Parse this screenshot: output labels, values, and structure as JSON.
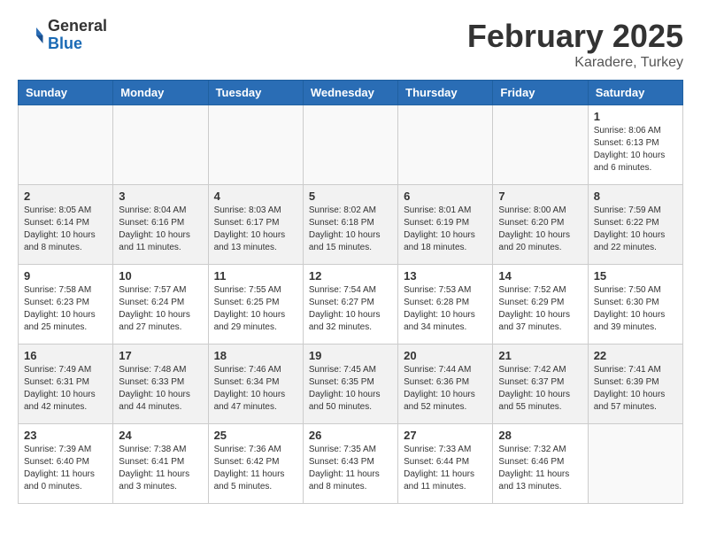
{
  "header": {
    "logo_line1": "General",
    "logo_line2": "Blue",
    "title": "February 2025",
    "subtitle": "Karadere, Turkey"
  },
  "columns": [
    "Sunday",
    "Monday",
    "Tuesday",
    "Wednesday",
    "Thursday",
    "Friday",
    "Saturday"
  ],
  "weeks": [
    {
      "alt": false,
      "days": [
        {
          "num": "",
          "info": ""
        },
        {
          "num": "",
          "info": ""
        },
        {
          "num": "",
          "info": ""
        },
        {
          "num": "",
          "info": ""
        },
        {
          "num": "",
          "info": ""
        },
        {
          "num": "",
          "info": ""
        },
        {
          "num": "1",
          "info": "Sunrise: 8:06 AM\nSunset: 6:13 PM\nDaylight: 10 hours\nand 6 minutes."
        }
      ]
    },
    {
      "alt": true,
      "days": [
        {
          "num": "2",
          "info": "Sunrise: 8:05 AM\nSunset: 6:14 PM\nDaylight: 10 hours\nand 8 minutes."
        },
        {
          "num": "3",
          "info": "Sunrise: 8:04 AM\nSunset: 6:16 PM\nDaylight: 10 hours\nand 11 minutes."
        },
        {
          "num": "4",
          "info": "Sunrise: 8:03 AM\nSunset: 6:17 PM\nDaylight: 10 hours\nand 13 minutes."
        },
        {
          "num": "5",
          "info": "Sunrise: 8:02 AM\nSunset: 6:18 PM\nDaylight: 10 hours\nand 15 minutes."
        },
        {
          "num": "6",
          "info": "Sunrise: 8:01 AM\nSunset: 6:19 PM\nDaylight: 10 hours\nand 18 minutes."
        },
        {
          "num": "7",
          "info": "Sunrise: 8:00 AM\nSunset: 6:20 PM\nDaylight: 10 hours\nand 20 minutes."
        },
        {
          "num": "8",
          "info": "Sunrise: 7:59 AM\nSunset: 6:22 PM\nDaylight: 10 hours\nand 22 minutes."
        }
      ]
    },
    {
      "alt": false,
      "days": [
        {
          "num": "9",
          "info": "Sunrise: 7:58 AM\nSunset: 6:23 PM\nDaylight: 10 hours\nand 25 minutes."
        },
        {
          "num": "10",
          "info": "Sunrise: 7:57 AM\nSunset: 6:24 PM\nDaylight: 10 hours\nand 27 minutes."
        },
        {
          "num": "11",
          "info": "Sunrise: 7:55 AM\nSunset: 6:25 PM\nDaylight: 10 hours\nand 29 minutes."
        },
        {
          "num": "12",
          "info": "Sunrise: 7:54 AM\nSunset: 6:27 PM\nDaylight: 10 hours\nand 32 minutes."
        },
        {
          "num": "13",
          "info": "Sunrise: 7:53 AM\nSunset: 6:28 PM\nDaylight: 10 hours\nand 34 minutes."
        },
        {
          "num": "14",
          "info": "Sunrise: 7:52 AM\nSunset: 6:29 PM\nDaylight: 10 hours\nand 37 minutes."
        },
        {
          "num": "15",
          "info": "Sunrise: 7:50 AM\nSunset: 6:30 PM\nDaylight: 10 hours\nand 39 minutes."
        }
      ]
    },
    {
      "alt": true,
      "days": [
        {
          "num": "16",
          "info": "Sunrise: 7:49 AM\nSunset: 6:31 PM\nDaylight: 10 hours\nand 42 minutes."
        },
        {
          "num": "17",
          "info": "Sunrise: 7:48 AM\nSunset: 6:33 PM\nDaylight: 10 hours\nand 44 minutes."
        },
        {
          "num": "18",
          "info": "Sunrise: 7:46 AM\nSunset: 6:34 PM\nDaylight: 10 hours\nand 47 minutes."
        },
        {
          "num": "19",
          "info": "Sunrise: 7:45 AM\nSunset: 6:35 PM\nDaylight: 10 hours\nand 50 minutes."
        },
        {
          "num": "20",
          "info": "Sunrise: 7:44 AM\nSunset: 6:36 PM\nDaylight: 10 hours\nand 52 minutes."
        },
        {
          "num": "21",
          "info": "Sunrise: 7:42 AM\nSunset: 6:37 PM\nDaylight: 10 hours\nand 55 minutes."
        },
        {
          "num": "22",
          "info": "Sunrise: 7:41 AM\nSunset: 6:39 PM\nDaylight: 10 hours\nand 57 minutes."
        }
      ]
    },
    {
      "alt": false,
      "days": [
        {
          "num": "23",
          "info": "Sunrise: 7:39 AM\nSunset: 6:40 PM\nDaylight: 11 hours\nand 0 minutes."
        },
        {
          "num": "24",
          "info": "Sunrise: 7:38 AM\nSunset: 6:41 PM\nDaylight: 11 hours\nand 3 minutes."
        },
        {
          "num": "25",
          "info": "Sunrise: 7:36 AM\nSunset: 6:42 PM\nDaylight: 11 hours\nand 5 minutes."
        },
        {
          "num": "26",
          "info": "Sunrise: 7:35 AM\nSunset: 6:43 PM\nDaylight: 11 hours\nand 8 minutes."
        },
        {
          "num": "27",
          "info": "Sunrise: 7:33 AM\nSunset: 6:44 PM\nDaylight: 11 hours\nand 11 minutes."
        },
        {
          "num": "28",
          "info": "Sunrise: 7:32 AM\nSunset: 6:46 PM\nDaylight: 11 hours\nand 13 minutes."
        },
        {
          "num": "",
          "info": ""
        }
      ]
    }
  ]
}
